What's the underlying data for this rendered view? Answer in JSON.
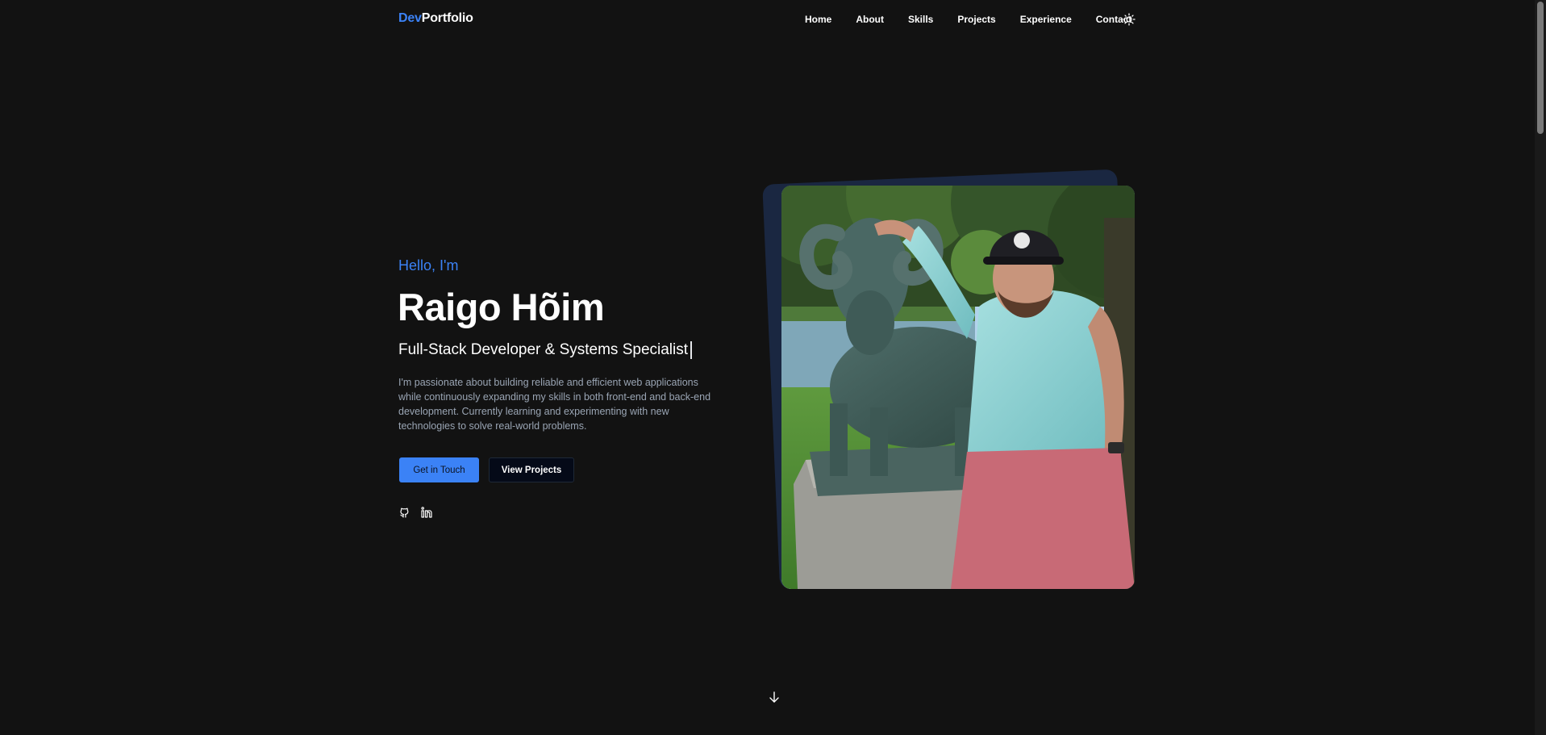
{
  "nav": {
    "logo_dev": "Dev",
    "logo_portfolio": "Portfolio",
    "links": [
      "Home",
      "About",
      "Skills",
      "Projects",
      "Experience",
      "Contact"
    ],
    "theme_icon": "sun-icon"
  },
  "hero": {
    "greeting": "Hello, I'm",
    "name": "Raigo Hõim",
    "role": "Full-Stack Developer & Systems Specialist",
    "bio": "I'm passionate about building reliable and efficient web applications while continuously expanding my skills in both front-end and back-end development. Currently learning and experimenting with new technologies to solve real-world problems.",
    "primary_button": "Get in Touch",
    "secondary_button": "View Projects",
    "social_icons": [
      "github-icon",
      "linkedin-icon"
    ],
    "scroll_icon": "arrow-down-icon"
  },
  "colors": {
    "background": "#121212",
    "accent": "#3b82f6",
    "bio_text": "#9aa5b4"
  }
}
